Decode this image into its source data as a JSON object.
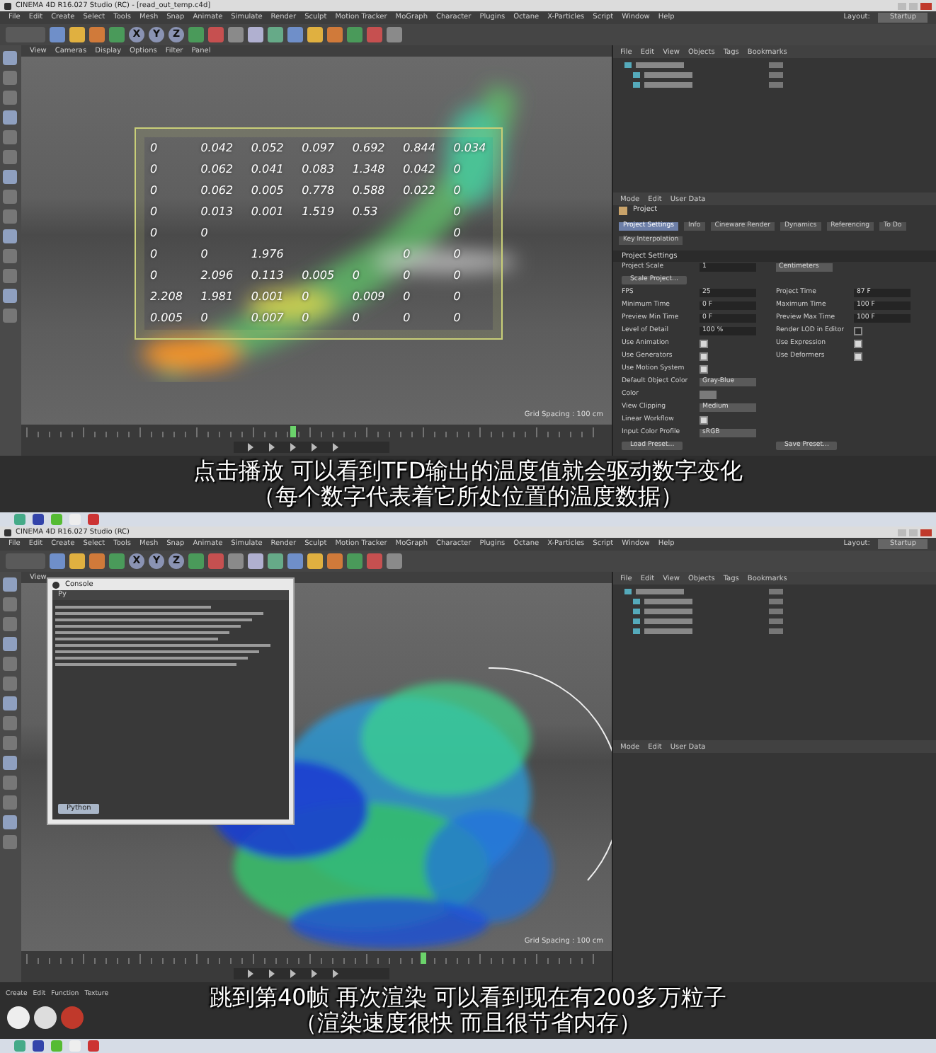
{
  "top_frame": {
    "window_title": "CINEMA 4D R16.027 Studio (RC) - [read_out_temp.c4d]",
    "menu": [
      "File",
      "Edit",
      "Create",
      "Select",
      "Tools",
      "Mesh",
      "Snap",
      "Animate",
      "Simulate",
      "Render",
      "Sculpt",
      "Motion Tracker",
      "MoGraph",
      "Character",
      "Plugins",
      "Octane",
      "X-Particles",
      "Script",
      "Window",
      "Help"
    ],
    "layout_label": "Layout:",
    "layout_value": "Startup",
    "toolbar_axes": [
      "X",
      "Y",
      "Z"
    ],
    "viewport_menu": [
      "View",
      "Cameras",
      "Display",
      "Options",
      "Filter",
      "Panel"
    ],
    "grid_spacing": "Grid Spacing : 100 cm",
    "number_grid": [
      {
        "column_1": "0",
        "column_2": "0.042",
        "column_3": "0.052",
        "column_4": "0.097",
        "column_5": "0.692",
        "column_6": "0.844",
        "column_7": "0.034"
      },
      {
        "column_1": "0",
        "column_2": "0.062",
        "column_3": "0.041",
        "column_4": "0.083",
        "column_5": "1.348",
        "column_6": "0.042",
        "column_7": "0"
      },
      {
        "column_1": "0",
        "column_2": "0.062",
        "column_3": "0.005",
        "column_4": "0.778",
        "column_5": "0.588",
        "column_6": "0.022",
        "column_7": "0"
      },
      {
        "column_1": "0",
        "column_2": "0.013",
        "column_3": "0.001",
        "column_4": "1.519",
        "column_5": "0.53",
        "column_7": "0"
      },
      {
        "column_1": "0",
        "column_2": "0",
        "column_7": "0"
      },
      {
        "column_1": "0",
        "column_2": "0",
        "column_3": "1.976",
        "column_6": "0",
        "column_7": "0"
      },
      {
        "column_1": "0",
        "column_2": "2.096",
        "column_3": "0.113",
        "column_4": "0.005",
        "column_5": "0",
        "column_6": "0",
        "column_7": "0"
      },
      {
        "column_1": "2.208",
        "column_2": "1.981",
        "column_3": "0.001",
        "column_4": "0",
        "column_5": "0.009",
        "column_6": "0",
        "column_7": "0"
      },
      {
        "column_1": "0.005",
        "column_2": "0",
        "column_3": "0.007",
        "column_4": "0",
        "column_5": "0",
        "column_6": "0",
        "column_7": "0"
      }
    ],
    "object_menu": [
      "File",
      "Edit",
      "View",
      "Objects",
      "Tags",
      "Bookmarks"
    ],
    "attribute_menu": [
      "Mode",
      "Edit",
      "User Data"
    ],
    "attribute_title": "Project",
    "attribute_tabs": [
      {
        "label": "Project Settings",
        "selected": true
      },
      {
        "label": "Info",
        "selected": false
      },
      {
        "label": "Cineware Render",
        "selected": false
      },
      {
        "label": "Dynamics",
        "selected": false
      },
      {
        "label": "Referencing",
        "selected": false
      },
      {
        "label": "To Do",
        "selected": false
      },
      {
        "label": "Key Interpolation",
        "selected": false
      }
    ],
    "section_title": "Project Settings",
    "attribute_rows": [
      [
        {
          "kind": "field",
          "label": "Project Scale",
          "value": "1"
        },
        {
          "kind": "dropdown",
          "value": "Centimeters"
        }
      ],
      [
        {
          "kind": "button",
          "label": "Scale Project..."
        }
      ],
      [
        {
          "kind": "field",
          "label": "FPS",
          "value": "25"
        },
        {
          "kind": "field",
          "label": "Project Time",
          "value": "87 F"
        }
      ],
      [
        {
          "kind": "field",
          "label": "Minimum Time",
          "value": "0 F"
        },
        {
          "kind": "field",
          "label": "Maximum Time",
          "value": "100 F"
        }
      ],
      [
        {
          "kind": "field",
          "label": "Preview Min Time",
          "value": "0 F"
        },
        {
          "kind": "field",
          "label": "Preview Max Time",
          "value": "100 F"
        }
      ],
      [
        {
          "kind": "field",
          "label": "Level of Detail",
          "value": "100 %"
        },
        {
          "kind": "check",
          "label": "Render LOD in Editor",
          "checked": false
        }
      ],
      [
        {
          "kind": "check",
          "label": "Use Animation",
          "checked": true
        },
        {
          "kind": "check",
          "label": "Use Expression",
          "checked": true
        }
      ],
      [
        {
          "kind": "check",
          "label": "Use Generators",
          "checked": true
        },
        {
          "kind": "check",
          "label": "Use Deformers",
          "checked": true
        }
      ],
      [
        {
          "kind": "check",
          "label": "Use Motion System",
          "checked": true
        }
      ],
      [
        {
          "kind": "dropdown",
          "label": "Default Object Color",
          "value": "Gray-Blue"
        }
      ],
      [
        {
          "kind": "swatch",
          "label": "Color"
        }
      ],
      [
        {
          "kind": "dropdown",
          "label": "View Clipping",
          "value": "Medium"
        }
      ],
      [
        {
          "kind": "check",
          "label": "Linear Workflow",
          "checked": true
        }
      ],
      [
        {
          "kind": "dropdown",
          "label": "Input Color Profile",
          "value": "sRGB"
        }
      ],
      [
        {
          "kind": "button",
          "label": "Load Preset..."
        },
        {
          "kind": "button",
          "label": "Save Preset..."
        }
      ]
    ],
    "subtitle": [
      "点击播放  可以看到TFD输出的温度值就会驱动数字变化",
      "（每个数字代表着它所处位置的温度数据）"
    ]
  },
  "bottom_frame": {
    "window_title": "CINEMA 4D R16.027 Studio (RC)",
    "menu": [
      "File",
      "Edit",
      "Create",
      "Select",
      "Tools",
      "Mesh",
      "Snap",
      "Animate",
      "Simulate",
      "Render",
      "Sculpt",
      "Motion Tracker",
      "MoGraph",
      "Character",
      "Plugins",
      "Octane",
      "X-Particles",
      "Script",
      "Window",
      "Help"
    ],
    "layout_label": "Layout:",
    "layout_value": "Startup",
    "toolbar_axes": [
      "X",
      "Y",
      "Z"
    ],
    "viewport_menu": [
      "View"
    ],
    "grid_spacing": "Grid Spacing : 100 cm",
    "console": {
      "title": "Console",
      "tab": "Py",
      "button": "Python"
    },
    "object_menu": [
      "File",
      "Edit",
      "View",
      "Objects",
      "Tags",
      "Bookmarks"
    ],
    "attribute_menu": [
      "Mode",
      "Edit",
      "User Data"
    ],
    "material_menu": [
      "Create",
      "Edit",
      "Function",
      "Texture"
    ],
    "subtitle": [
      "跳到第40帧  再次渲染  可以看到现在有200多万粒子",
      "（渲染速度很快  而且很节省内存）"
    ]
  }
}
